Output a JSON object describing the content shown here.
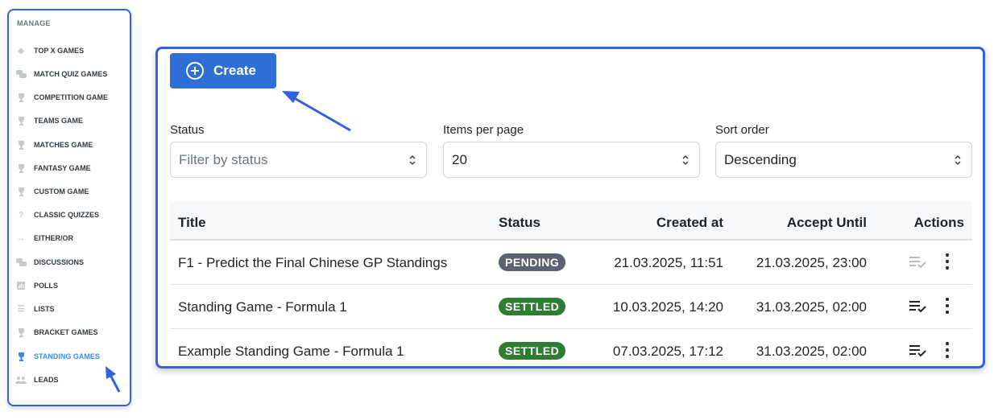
{
  "sidebar": {
    "heading": "MANAGE",
    "items": [
      {
        "label": "TOP X GAMES",
        "icon": "diamond-icon"
      },
      {
        "label": "MATCH QUIZ GAMES",
        "icon": "chat-bubbles-icon"
      },
      {
        "label": "COMPETITION GAME",
        "icon": "trophy-icon"
      },
      {
        "label": "TEAMS GAME",
        "icon": "trophy-icon"
      },
      {
        "label": "MATCHES GAME",
        "icon": "trophy-icon"
      },
      {
        "label": "FANTASY GAME",
        "icon": "trophy-icon"
      },
      {
        "label": "CUSTOM GAME",
        "icon": "trophy-icon"
      },
      {
        "label": "CLASSIC QUIZZES",
        "icon": "question-icon"
      },
      {
        "label": "EITHER/OR",
        "icon": "arrows-left-right-icon"
      },
      {
        "label": "DISCUSSIONS",
        "icon": "chat-bubbles-icon"
      },
      {
        "label": "POLLS",
        "icon": "poll-icon"
      },
      {
        "label": "LISTS",
        "icon": "list-icon"
      },
      {
        "label": "BRACKET GAMES",
        "icon": "trophy-icon"
      },
      {
        "label": "STANDING GAMES",
        "icon": "trophy-icon",
        "active": true
      },
      {
        "label": "LEADS",
        "icon": "users-icon"
      }
    ],
    "active_color": "#3a8be8"
  },
  "toolbar": {
    "create_label": "Create",
    "create_color": "#2e6fd6"
  },
  "filters": {
    "status": {
      "label": "Status",
      "placeholder": "Filter by status"
    },
    "items_per_page": {
      "label": "Items per page",
      "value": "20"
    },
    "sort_order": {
      "label": "Sort order",
      "value": "Descending"
    }
  },
  "table": {
    "columns": [
      "Title",
      "Status",
      "Created at",
      "Accept Until",
      "Actions"
    ],
    "rows": [
      {
        "title": "F1 - Predict the Final Chinese GP Standings",
        "status": "PENDING",
        "status_color": "#5c6370",
        "created": "21.03.2025, 11:51",
        "accept_until": "21.03.2025, 23:00",
        "settle_enabled": false
      },
      {
        "title": "Standing Game - Formula 1",
        "status": "SETTLED",
        "status_color": "#2f7d32",
        "created": "10.03.2025, 14:20",
        "accept_until": "31.03.2025, 02:00",
        "settle_enabled": true
      },
      {
        "title": "Example Standing Game - Formula 1",
        "status": "SETTLED",
        "status_color": "#2f7d32",
        "created": "07.03.2025, 17:12",
        "accept_until": "31.03.2025, 02:00",
        "settle_enabled": true
      }
    ]
  },
  "accent_color": "#2f63e0"
}
